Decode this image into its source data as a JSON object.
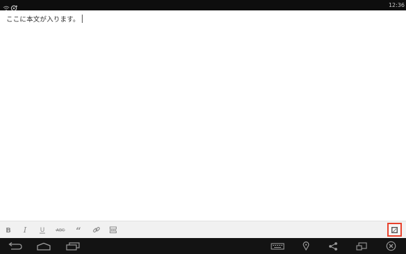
{
  "status_bar": {
    "clock": "12:36",
    "notification_icons": [
      "wifi-icon",
      "sync-icon"
    ]
  },
  "editor": {
    "body_text": "ここに本文が入ります。"
  },
  "format_toolbar": {
    "buttons": [
      {
        "name": "bold",
        "icon": "bold-icon"
      },
      {
        "name": "italic",
        "icon": "italic-icon"
      },
      {
        "name": "underline",
        "icon": "underline-icon"
      },
      {
        "name": "strikethrough",
        "icon": "strikethrough-icon"
      },
      {
        "name": "blockquote",
        "icon": "quote-icon"
      },
      {
        "name": "link",
        "icon": "link-icon"
      },
      {
        "name": "more",
        "icon": "more-icon"
      }
    ],
    "toggle_button": {
      "icon": "html-edit-icon",
      "highlighted": true,
      "highlight_color": "#e8412c"
    }
  },
  "nav_bar": {
    "left": [
      "back-icon",
      "home-icon",
      "recent-apps-icon"
    ],
    "right": [
      "keyboard-icon",
      "location-icon",
      "share-icon",
      "window-icon",
      "close-circle-icon"
    ]
  }
}
